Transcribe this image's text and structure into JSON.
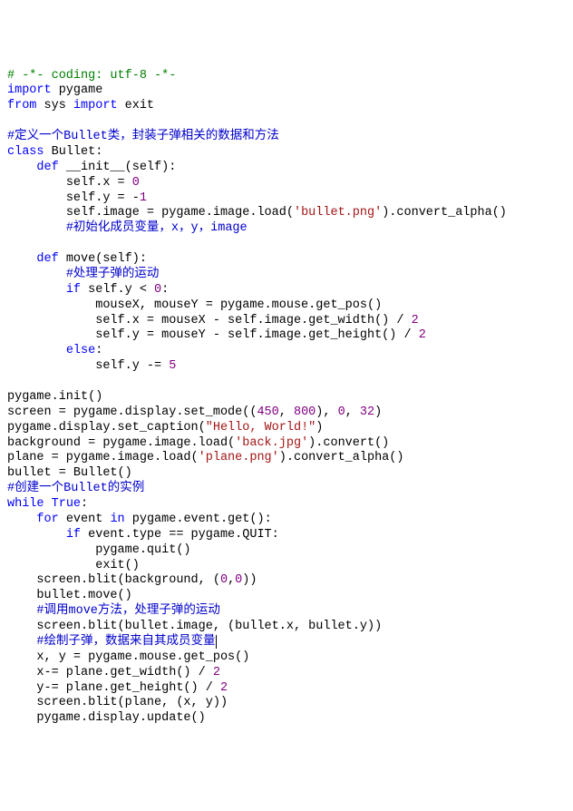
{
  "code": {
    "l01": {
      "c1": "# -*- coding: utf-8 -*-"
    },
    "l02": {
      "kw1": "import",
      "id1": " pygame"
    },
    "l03": {
      "kw1": "from",
      "id1": " sys ",
      "kw2": "import",
      "id2": " exit"
    },
    "l05": {
      "c1": "#定义一个Bullet类，封装子弹相关的数据和方法"
    },
    "l06": {
      "kw1": "class",
      "id1": " Bullet:"
    },
    "l07": {
      "sp": "    ",
      "kw1": "def",
      "id1": " __init__(self):"
    },
    "l08": {
      "sp": "        ",
      "t1": "self.x = ",
      "n1": "0"
    },
    "l09": {
      "sp": "        ",
      "t1": "self.y = -",
      "n1": "1"
    },
    "l10": {
      "sp": "        ",
      "t1": "self.image = pygame.image.load(",
      "s1": "'bullet.png'",
      "t2": ").convert_alpha()"
    },
    "l11": {
      "sp": "        ",
      "c1": "#初始化成员变量，x，y，image"
    },
    "l13": {
      "sp": "    ",
      "kw1": "def",
      "id1": " move(self):"
    },
    "l14": {
      "sp": "        ",
      "c1": "#处理子弹的运动"
    },
    "l15": {
      "sp": "        ",
      "kw1": "if",
      "t1": " self.y < ",
      "n1": "0",
      "t2": ":"
    },
    "l16": {
      "sp": "            ",
      "t1": "mouseX, mouseY = pygame.mouse.get_pos()"
    },
    "l17": {
      "sp": "            ",
      "t1": "self.x = mouseX - self.image.get_width() / ",
      "n1": "2"
    },
    "l18": {
      "sp": "            ",
      "t1": "self.y = mouseY - self.image.get_height() / ",
      "n1": "2"
    },
    "l19": {
      "sp": "        ",
      "kw1": "else",
      "t1": ":"
    },
    "l20": {
      "sp": "            ",
      "t1": "self.y -= ",
      "n1": "5"
    },
    "l22": {
      "t1": "pygame.init()"
    },
    "l23": {
      "t1": "screen = pygame.display.set_mode((",
      "n1": "450",
      "t2": ", ",
      "n2": "800",
      "t3": "), ",
      "n3": "0",
      "t4": ", ",
      "n4": "32",
      "t5": ")"
    },
    "l24": {
      "t1": "pygame.display.set_caption(",
      "s1": "\"Hello, World!\"",
      "t2": ")"
    },
    "l25": {
      "t1": "background = pygame.image.load(",
      "s1": "'back.jpg'",
      "t2": ").convert()"
    },
    "l26": {
      "t1": "plane = pygame.image.load(",
      "s1": "'plane.png'",
      "t2": ").convert_alpha()"
    },
    "l27": {
      "t1": "bullet = Bullet()"
    },
    "l28": {
      "c1": "#创建一个Bullet的实例"
    },
    "l29": {
      "kw1": "while",
      "t1": " ",
      "kw2": "True",
      "t2": ":"
    },
    "l30": {
      "sp": "    ",
      "kw1": "for",
      "t1": " event ",
      "kw2": "in",
      "t2": " pygame.event.get():"
    },
    "l31": {
      "sp": "        ",
      "kw1": "if",
      "t1": " event.type == pygame.QUIT:"
    },
    "l32": {
      "sp": "            ",
      "t1": "pygame.quit()"
    },
    "l33": {
      "sp": "            ",
      "t1": "exit()"
    },
    "l34": {
      "sp": "    ",
      "t1": "screen.blit(background, (",
      "n1": "0",
      "t2": ",",
      "n2": "0",
      "t3": "))"
    },
    "l35": {
      "sp": "    ",
      "t1": "bullet.move()"
    },
    "l36": {
      "sp": "    ",
      "c1": "#调用move方法，处理子弹的运动"
    },
    "l37": {
      "sp": "    ",
      "t1": "screen.blit(bullet.image, (bullet.x, bullet.y))"
    },
    "l38": {
      "sp": "    ",
      "c1": "#绘制子弹，数据来自其成员变量"
    },
    "l39": {
      "sp": "    ",
      "t1": "x, y = pygame.mouse.get_pos()"
    },
    "l40": {
      "sp": "    ",
      "t1": "x-= plane.get_width() / ",
      "n1": "2"
    },
    "l41": {
      "sp": "    ",
      "t1": "y-= plane.get_height() / ",
      "n1": "2"
    },
    "l42": {
      "sp": "    ",
      "t1": "screen.blit(plane, (x, y))"
    },
    "l43": {
      "sp": "    ",
      "t1": "pygame.display.update()"
    }
  }
}
